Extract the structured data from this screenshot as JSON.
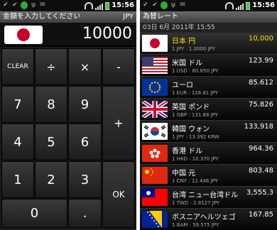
{
  "status": {
    "time": "15:56"
  },
  "calculator": {
    "title": "金額を入力してください",
    "currency": "JPY",
    "amount": "10000",
    "keys": {
      "clear": "CLEAR",
      "divide": "÷",
      "multiply": "×",
      "minus": "-",
      "k7": "7",
      "k8": "8",
      "k9": "9",
      "plus": "+",
      "k4": "4",
      "k5": "5",
      "k6": "6",
      "k1": "1",
      "k2": "2",
      "k3": "3",
      "ok": "OK",
      "k0": "0",
      "dot": "."
    }
  },
  "rates": {
    "title": "為替レート",
    "date": "03日 6月 2011年 15:55",
    "items": [
      {
        "name": "日本 円",
        "value": "10,000",
        "sub": "1 JPY : 1.0000 JPY",
        "selected": true
      },
      {
        "name": "米国 ドル",
        "value": "123.99",
        "sub": "1 USD : 80.650 JPY"
      },
      {
        "name": "ユーロ",
        "value": "85.612",
        "sub": "1 EUR : 116.81 JPY"
      },
      {
        "name": "英国 ポンド",
        "value": "75.826",
        "sub": "1 GBP : 131.88 JPY"
      },
      {
        "name": "韓国 ウォン",
        "value": "133,918",
        "sub": "1 JPY : 13.392 KRW"
      },
      {
        "name": "香港 ドル",
        "value": "964.36",
        "sub": "1 HKD : 10.370 JPY"
      },
      {
        "name": "中国 元",
        "value": "803.48",
        "sub": "1 CNY : 12.446 JPY"
      },
      {
        "name": "台湾 ニュー台湾ドル",
        "value": "3,555.3",
        "sub": "1 TWD : 2.8127 JPY"
      },
      {
        "name": "ボスニアヘルツェゴ",
        "value": "167.85",
        "sub": "1 BAM : 59.575 JPY"
      }
    ]
  }
}
